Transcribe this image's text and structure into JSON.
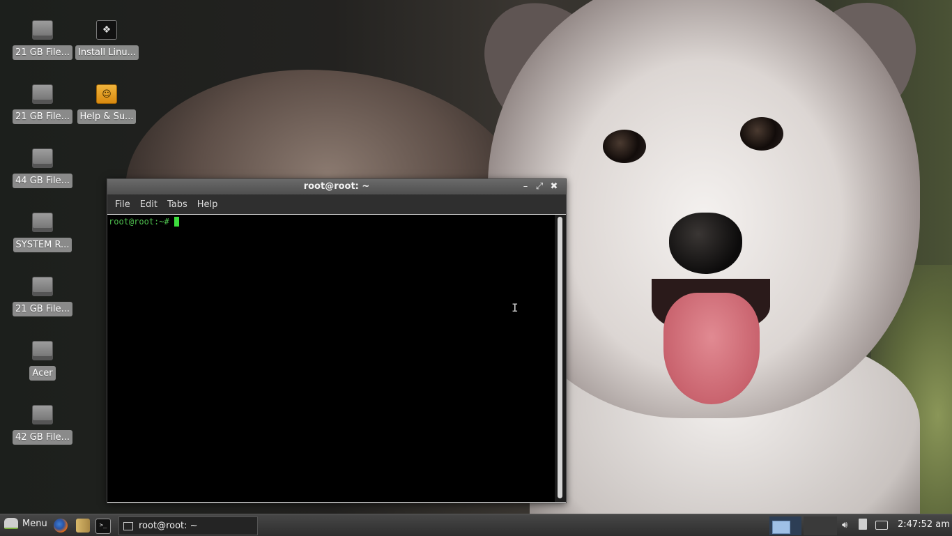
{
  "desktop": {
    "icons": [
      {
        "label": "21 GB File...",
        "icon": "drive-icon"
      },
      {
        "label": "Install Linu...",
        "icon": "install-icon"
      },
      {
        "label": "21 GB File...",
        "icon": "drive-icon"
      },
      {
        "label": "Help & Su...",
        "icon": "help-icon"
      },
      {
        "label": "44 GB File...",
        "icon": "drive-icon"
      },
      {
        "label": "SYSTEM R...",
        "icon": "drive-icon"
      },
      {
        "label": "21 GB File...",
        "icon": "drive-icon"
      },
      {
        "label": "Acer",
        "icon": "drive-icon"
      },
      {
        "label": "42 GB File...",
        "icon": "drive-icon"
      }
    ]
  },
  "terminal": {
    "title": "root@root: ~",
    "menu": [
      "File",
      "Edit",
      "Tabs",
      "Help"
    ],
    "prompt": "root@root:~# ",
    "buttons": {
      "minimize": "minimize-icon",
      "maximize": "maximize-icon",
      "close": "close-icon"
    }
  },
  "panel": {
    "menu_label": "Menu",
    "launchers": [
      "firefox-icon",
      "files-icon",
      "terminal-icon"
    ],
    "task_label": "root@root: ~",
    "tray_icons": [
      "volume-icon",
      "network-icon",
      "battery-icon"
    ],
    "clock": "2:47:52 am"
  },
  "colors": {
    "prompt": "#4ec04e",
    "panel": "#3a3a3a",
    "terminal_bg": "#000000"
  }
}
